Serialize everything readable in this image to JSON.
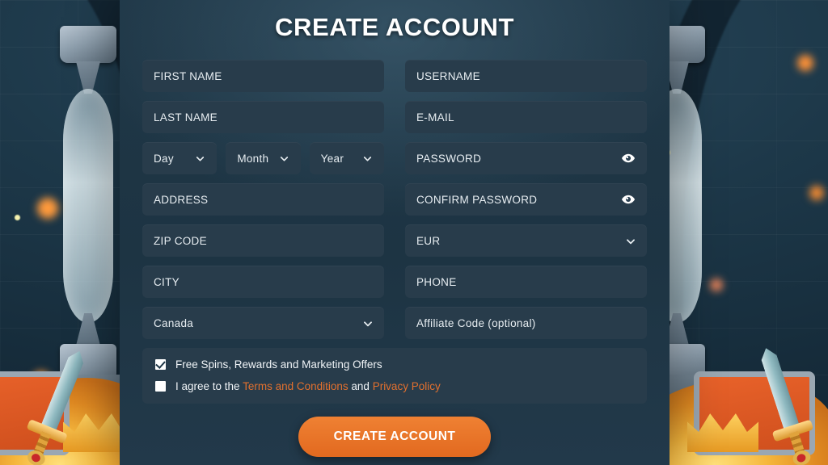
{
  "page": {
    "title": "CREATE ACCOUNT",
    "accent_color": "#e2702e",
    "panel_color": "#1f3747",
    "field_color": "#283c4b"
  },
  "form": {
    "left_column": [
      {
        "name": "first-name",
        "placeholder": "FIRST NAME",
        "type": "text"
      },
      {
        "name": "last-name",
        "placeholder": "LAST NAME",
        "type": "text"
      },
      {
        "name": "address",
        "placeholder": "ADDRESS",
        "type": "text"
      },
      {
        "name": "zip-code",
        "placeholder": "ZIP CODE",
        "type": "text"
      },
      {
        "name": "city",
        "placeholder": "CITY",
        "type": "text"
      }
    ],
    "date_of_birth": [
      {
        "name": "day",
        "value": "Day",
        "icon": "chevron-down-icon"
      },
      {
        "name": "month",
        "value": "Month",
        "icon": "chevron-down-icon"
      },
      {
        "name": "year",
        "value": "Year",
        "icon": "chevron-down-icon"
      }
    ],
    "country": {
      "value": "Canada",
      "icon": "chevron-down-icon"
    },
    "right_column": [
      {
        "name": "username",
        "placeholder": "USERNAME",
        "type": "text"
      },
      {
        "name": "email",
        "placeholder": "E-MAIL",
        "type": "email"
      },
      {
        "name": "password",
        "placeholder": "PASSWORD",
        "type": "password",
        "icon": "eye-icon"
      },
      {
        "name": "confirm-password",
        "placeholder": "CONFIRM PASSWORD",
        "type": "password",
        "icon": "eye-icon"
      }
    ],
    "currency": {
      "value": "EUR",
      "icon": "chevron-down-icon"
    },
    "phone": {
      "placeholder": "PHONE"
    },
    "affiliate": {
      "placeholder": "Affiliate Code (optional)"
    }
  },
  "consent": {
    "marketing": {
      "label": "Free Spins, Rewards and Marketing Offers",
      "checked": true
    },
    "terms": {
      "checked": false,
      "prefix": "I agree to the ",
      "terms_link": "Terms and Conditions",
      "conjunction": " and ",
      "privacy_link": "Privacy Policy"
    }
  },
  "submit": {
    "label": "CREATE ACCOUNT"
  }
}
